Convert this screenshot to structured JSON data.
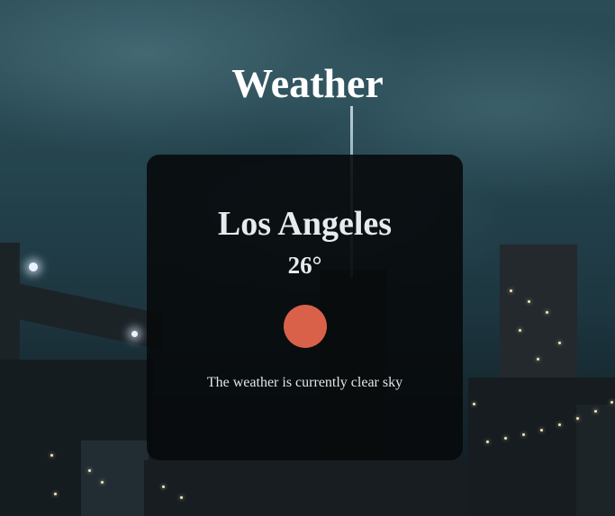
{
  "page": {
    "title": "Weather"
  },
  "weather_card": {
    "city": "Los Angeles",
    "temperature": "26°",
    "icon": "sun-icon",
    "icon_color": "#d9614a",
    "description": "The weather is currently clear sky"
  },
  "background": {
    "scene": "night city skyline with bridge"
  }
}
